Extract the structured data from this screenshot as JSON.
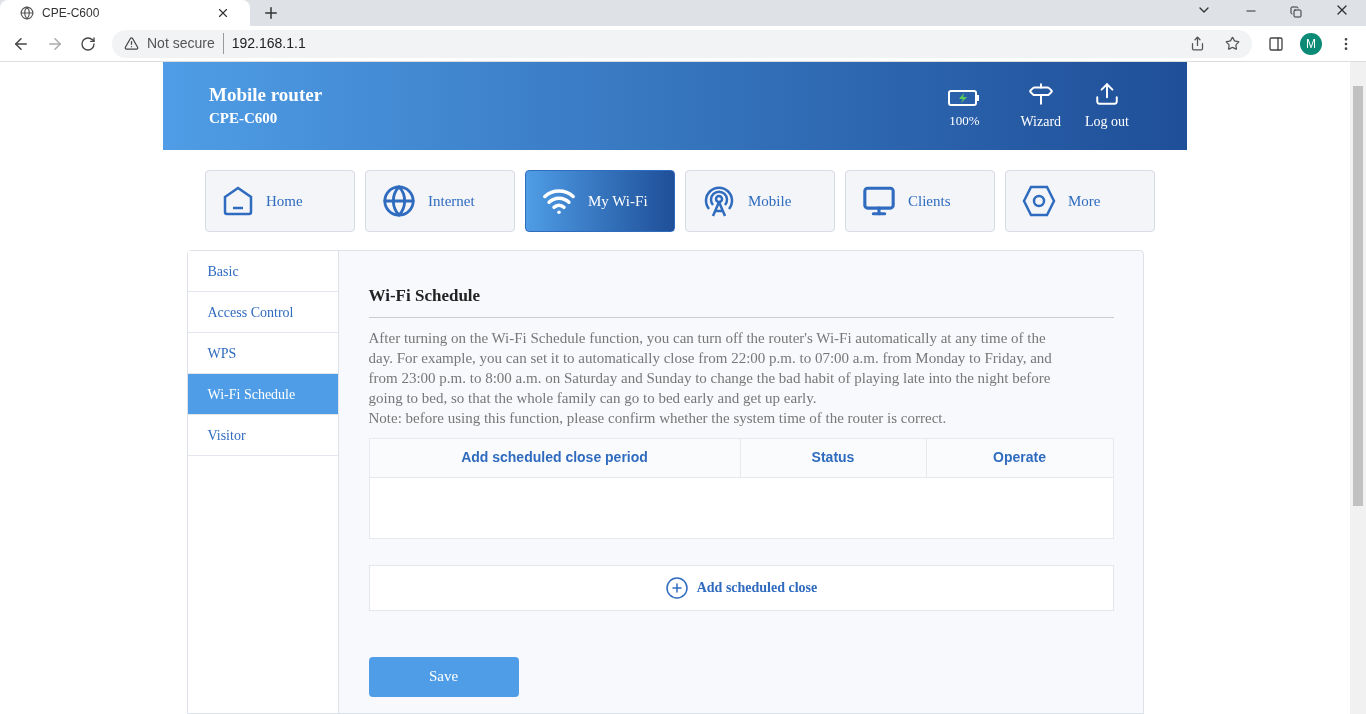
{
  "browser": {
    "tab_title": "CPE-C600",
    "security": "Not secure",
    "url": "192.168.1.1",
    "profile_initial": "M"
  },
  "header": {
    "title": "Mobile router",
    "model": "CPE-C600",
    "battery": "100%",
    "actions": [
      "Wizard",
      "Log out"
    ]
  },
  "nav": [
    {
      "label": "Home",
      "kind": "home",
      "selected": false
    },
    {
      "label": "Internet",
      "kind": "globe",
      "selected": false
    },
    {
      "label": "My Wi-Fi",
      "kind": "wifi",
      "selected": true
    },
    {
      "label": "Mobile",
      "kind": "antenna",
      "selected": false
    },
    {
      "label": "Clients",
      "kind": "monitor",
      "selected": false
    },
    {
      "label": "More",
      "kind": "more",
      "selected": false
    }
  ],
  "sidebar": {
    "items": [
      {
        "label": "Basic",
        "selected": false
      },
      {
        "label": "Access Control",
        "selected": false
      },
      {
        "label": "WPS",
        "selected": false
      },
      {
        "label": "Wi-Fi Schedule",
        "selected": true
      },
      {
        "label": "Visitor",
        "selected": false
      }
    ]
  },
  "content": {
    "title": "Wi-Fi Schedule",
    "description": "After turning on the Wi-Fi Schedule function, you can turn off the router's Wi-Fi automatically at any time of the day. For example, you can set it to automatically close from 22:00 p.m. to 07:00 a.m. from Monday to Friday, and from 23:00 p.m. to 8:00 a.m. on Saturday and Sunday to change the bad habit of playing late into the night before going to bed, so that the whole family can go to bed early and get up early.",
    "note": "Note: before using this function, please confirm whether the system time of the router is correct.",
    "table": {
      "columns": [
        "Add scheduled close period",
        "Status",
        "Operate"
      ]
    },
    "add_button": "Add scheduled close",
    "save_button": "Save"
  }
}
